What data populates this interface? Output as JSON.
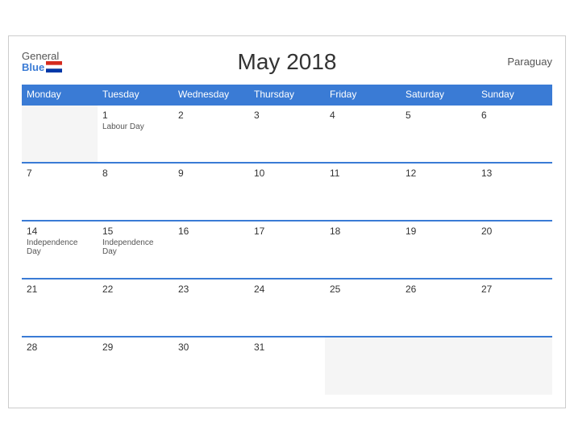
{
  "header": {
    "title": "May 2018",
    "country": "Paraguay",
    "logo": {
      "general": "General",
      "blue": "Blue"
    }
  },
  "weekdays": [
    "Monday",
    "Tuesday",
    "Wednesday",
    "Thursday",
    "Friday",
    "Saturday",
    "Sunday"
  ],
  "weeks": [
    [
      {
        "day": "",
        "empty": true
      },
      {
        "day": "1",
        "event": "Labour Day"
      },
      {
        "day": "2",
        "event": ""
      },
      {
        "day": "3",
        "event": ""
      },
      {
        "day": "4",
        "event": ""
      },
      {
        "day": "5",
        "event": ""
      },
      {
        "day": "6",
        "event": ""
      }
    ],
    [
      {
        "day": "7",
        "event": ""
      },
      {
        "day": "8",
        "event": ""
      },
      {
        "day": "9",
        "event": ""
      },
      {
        "day": "10",
        "event": ""
      },
      {
        "day": "11",
        "event": ""
      },
      {
        "day": "12",
        "event": ""
      },
      {
        "day": "13",
        "event": ""
      }
    ],
    [
      {
        "day": "14",
        "event": "Independence Day"
      },
      {
        "day": "15",
        "event": "Independence Day"
      },
      {
        "day": "16",
        "event": ""
      },
      {
        "day": "17",
        "event": ""
      },
      {
        "day": "18",
        "event": ""
      },
      {
        "day": "19",
        "event": ""
      },
      {
        "day": "20",
        "event": ""
      }
    ],
    [
      {
        "day": "21",
        "event": ""
      },
      {
        "day": "22",
        "event": ""
      },
      {
        "day": "23",
        "event": ""
      },
      {
        "day": "24",
        "event": ""
      },
      {
        "day": "25",
        "event": ""
      },
      {
        "day": "26",
        "event": ""
      },
      {
        "day": "27",
        "event": ""
      }
    ],
    [
      {
        "day": "28",
        "event": ""
      },
      {
        "day": "29",
        "event": ""
      },
      {
        "day": "30",
        "event": ""
      },
      {
        "day": "31",
        "event": ""
      },
      {
        "day": "",
        "empty": true
      },
      {
        "day": "",
        "empty": true
      },
      {
        "day": "",
        "empty": true
      }
    ]
  ]
}
